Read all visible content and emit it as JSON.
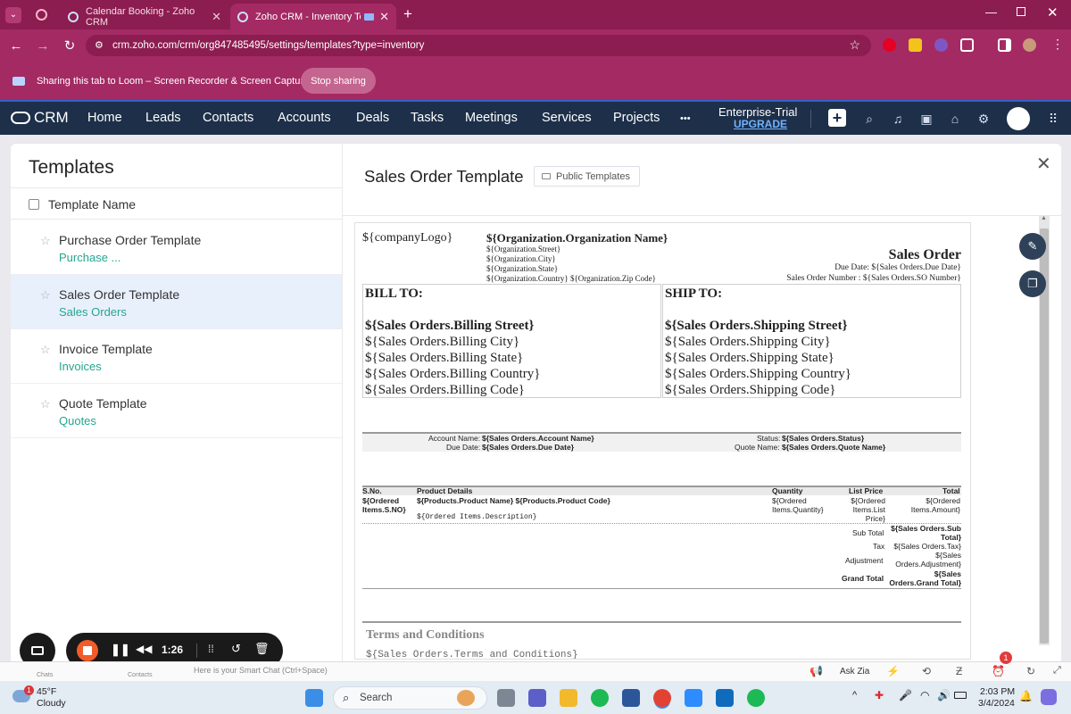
{
  "browser": {
    "tabs": [
      {
        "title": "Calendar Booking - Zoho CRM",
        "active": false
      },
      {
        "title": "Zoho CRM - Inventory Temp",
        "active": true
      }
    ],
    "url": "crm.zoho.com/crm/org847485495/settings/templates?type=inventory",
    "share_text": "Sharing this tab to Loom – Screen Recorder & Screen Capture",
    "stop_sharing": "Stop sharing"
  },
  "crm_nav": {
    "brand": "CRM",
    "items": [
      "Home",
      "Leads",
      "Contacts",
      "Accounts",
      "Deals",
      "Tasks",
      "Meetings",
      "Services",
      "Projects"
    ],
    "more": "•••",
    "trial": "Enterprise-Trial",
    "upgrade": "UPGRADE"
  },
  "left_panel": {
    "title": "Templates",
    "column_header": "Template Name",
    "templates": [
      {
        "name": "Purchase Order Template",
        "module": "Purchase ..."
      },
      {
        "name": "Sales Order Template",
        "module": "Sales Orders",
        "selected": true
      },
      {
        "name": "Invoice Template",
        "module": "Invoices"
      },
      {
        "name": "Quote Template",
        "module": "Quotes"
      }
    ]
  },
  "preview": {
    "title": "Sales Order Template",
    "folder_badge": "Public Templates",
    "doc": {
      "logo": "${companyLogo}",
      "org_name": "${Organization.Organization Name}",
      "org_street": "${Organization.Street}",
      "org_city": "${Organization.City}",
      "org_state": "${Organization.State}",
      "org_country_zip": "${Organization.Country} ${Organization.Zip Code}",
      "doc_title": "Sales Order",
      "due_date_line": "Due Date: ${Sales Orders.Due Date}",
      "so_number_line": "Sales Order Number : ${Sales Orders.SO Number}",
      "bill_to": "BILL TO:",
      "ship_to": "SHIP TO:",
      "billing": [
        "${Sales Orders.Billing Street}",
        "${Sales Orders.Billing City}",
        "${Sales Orders.Billing State}",
        "${Sales Orders.Billing Country}",
        "${Sales Orders.Billing Code}"
      ],
      "shipping": [
        "${Sales Orders.Shipping Street}",
        "${Sales Orders.Shipping City}",
        "${Sales Orders.Shipping State}",
        "${Sales Orders.Shipping Country}",
        "${Sales Orders.Shipping Code}"
      ],
      "info": {
        "account_label": "Account Name:",
        "account_value": "${Sales Orders.Account Name}",
        "due_label": "Due Date:",
        "due_value": "${Sales Orders.Due Date}",
        "status_label": "Status:",
        "status_value": "${Sales Orders.Status}",
        "quote_label": "Quote Name:",
        "quote_value": "${Sales Orders.Quote Name}"
      },
      "items_headers": [
        "S.No.",
        "Product Details",
        "Quantity",
        "List Price",
        "Total"
      ],
      "items_row": {
        "sno": "${Ordered Items.S.NO}",
        "product": "${Products.Product Name} ${Products.Product Code}",
        "description": "${Ordered Items.Description}",
        "quantity": "${Ordered Items.Quantity}",
        "list_price": "${Ordered Items.List Price}",
        "total": "${Ordered Items.Amount}"
      },
      "totals": [
        {
          "label": "Sub Total",
          "value": "${Sales Orders.Sub Total}"
        },
        {
          "label": "Tax",
          "value": "${Sales Orders.Tax}"
        },
        {
          "label": "Adjustment",
          "value": "${Sales Orders.Adjustment}"
        },
        {
          "label": "Grand Total",
          "value": "${Sales Orders.Grand Total}"
        }
      ],
      "terms_title": "Terms and Conditions",
      "terms_value": "${Sales Orders.Terms and Conditions}"
    }
  },
  "loom": {
    "timer": "1:26"
  },
  "crm_footer": {
    "chats": "Chats",
    "contacts": "Contacts",
    "smart_chat": "Here is your Smart Chat (Ctrl+Space)",
    "ask_zia": "Ask Zia",
    "alarm_count": "1"
  },
  "taskbar": {
    "weather_temp": "45°F",
    "weather_desc": "Cloudy",
    "weather_badge": "1",
    "search": "Search",
    "time": "2:03 PM",
    "date": "3/4/2024"
  },
  "colors": {
    "browser_accent": "#a42a63",
    "crm_nav": "#1d2f49",
    "module_link": "#25a68f",
    "upgrade": "#6fb3ff"
  }
}
